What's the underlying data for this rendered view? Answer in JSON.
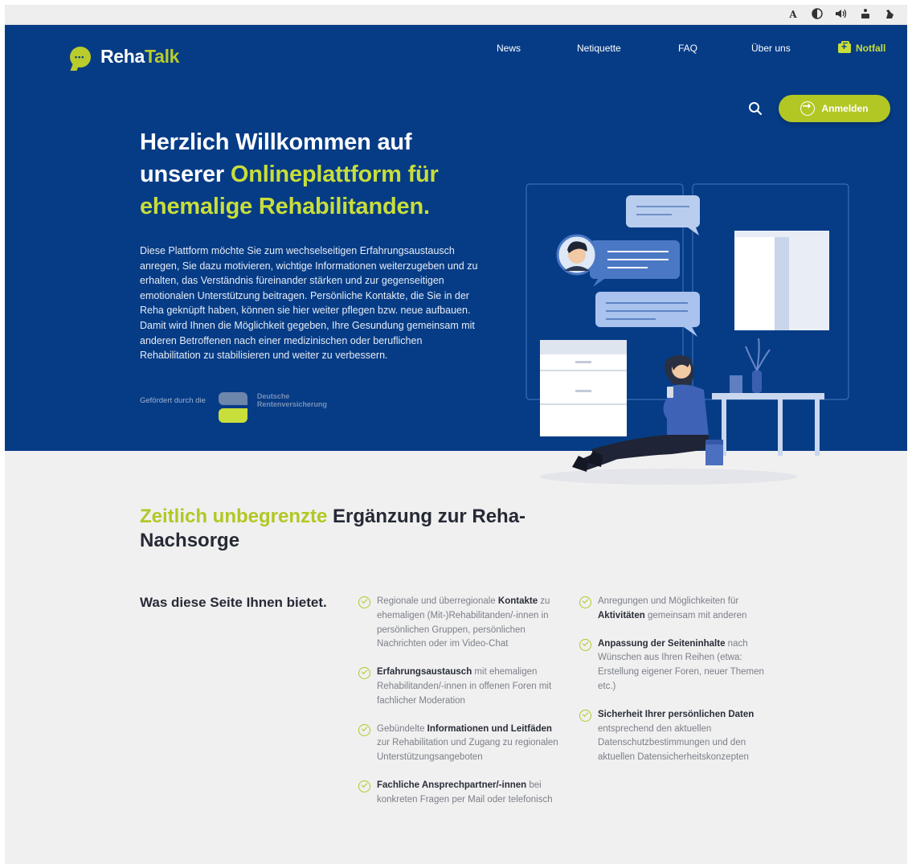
{
  "utility_bar": {
    "icons": [
      "font-size-icon",
      "contrast-icon",
      "audio-icon",
      "sign-language-icon",
      "simple-language-icon"
    ],
    "font_size_glyph": "A"
  },
  "brand": {
    "name_part1": "Reha",
    "name_part2": "Talk",
    "accent_color": "#b9cc2c",
    "primary_color": "#063c86"
  },
  "nav": {
    "items": [
      "News",
      "Netiquette",
      "FAQ",
      "Über uns"
    ],
    "emergency_label": "Notfall"
  },
  "header_actions": {
    "login_label": "Anmelden"
  },
  "hero": {
    "headline_part1": "Herzlich Willkommen auf unserer ",
    "headline_accent": "Onlineplattform für ehemalige Rehabilitanden.",
    "intro": "Diese Plattform möchte Sie zum wechselseitigen Erfahrungsaustausch anregen, Sie dazu motivieren, wichtige Informationen weiterzugeben und zu erhalten, das Verständnis füreinander stärken und zur gegenseitigen emotionalen Unterstützung beitragen. Persönliche Kontakte, die Sie in der Reha geknüpft haben, können sie hier weiter pflegen bzw. neue aufbauen. Damit wird Ihnen die Möglichkeit gegeben, Ihre Gesundung gemeinsam mit anderen Betroffenen nach einer medizinischen oder beruflichen Rehabilitation zu stabilisieren und weiter zu verbessern.",
    "funding_label": "Gefördert durch die",
    "funder_line1": "Deutsche",
    "funder_line2": "Rentenversicherung"
  },
  "section": {
    "title_accent": "Zeitlich unbegrenzte",
    "title_rest": " Ergänzung zur Reha-Nachsorge",
    "subtitle": "Was diese Seite Ihnen bietet.",
    "features_col1": [
      {
        "pre": "Regionale und überregionale ",
        "bold": "Kontakte",
        "post": " zu ehemaligen (Mit-)Rehabilitanden/-innen in persönlichen Gruppen, persönlichen Nachrichten oder im Video-Chat"
      },
      {
        "pre": "",
        "bold": "Erfahrungsaustausch",
        "post": " mit ehemaligen Rehabilitanden/-innen in offenen Foren mit fachlicher Moderation"
      },
      {
        "pre": "Gebündelte ",
        "bold": "Informationen und Leitfäden",
        "post": " zur Rehabilitation und Zugang zu regionalen Unterstützungsangeboten"
      },
      {
        "pre": "",
        "bold": "Fachliche Ansprechpartner/-innen",
        "post": " bei konkreten Fragen per Mail oder telefonisch"
      }
    ],
    "features_col2": [
      {
        "pre": "Anregungen und Möglichkeiten für ",
        "bold": "Aktivitäten",
        "post": " gemeinsam mit anderen"
      },
      {
        "pre": "",
        "bold": "Anpassung der Seiteninhalte",
        "post": " nach Wünschen aus Ihren Reihen (etwa: Erstellung eigener Foren, neuer Themen etc.)"
      },
      {
        "pre": "",
        "bold": "Sicherheit Ihrer persönlichen Daten",
        "post": " entsprechend den aktuellen Datenschutzbestimmungen und den aktuellen Datensicherheitskonzepten"
      }
    ]
  }
}
